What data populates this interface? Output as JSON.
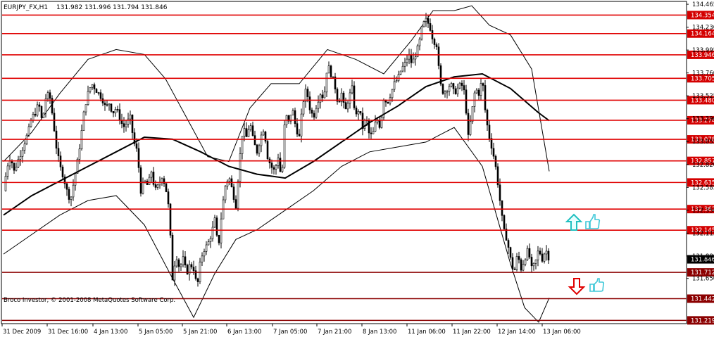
{
  "header": {
    "symbol": "EURJPY_FX,H1",
    "ohlc": "131.982 131.996 131.794 131.846"
  },
  "footer": {
    "copyright": "Broco Investor, © 2001-2008 MetaQuotes Software Corp."
  },
  "colors": {
    "level_line": "#e00000",
    "level_line_dark": "#8b0000",
    "level_tag": "#d40000",
    "candle": "#000000",
    "band": "#000000",
    "price_tag": "#000000",
    "arrow_up": "#20c0c0",
    "arrow_down": "#e00000",
    "thumb": "#40c8d8"
  },
  "icons": {
    "arrow_up": "arrow-up-icon",
    "arrow_down": "arrow-down-icon",
    "thumb_up": "thumbs-up-icon",
    "thumb_down": "thumbs-down-icon"
  },
  "chart_data": {
    "type": "candlestick",
    "ylim": [
      131.2,
      134.48
    ],
    "y_ticks": [
      "134.465",
      "134.230",
      "133.995",
      "133.760",
      "133.525",
      "133.290",
      "133.055",
      "132.820",
      "132.585",
      "132.350",
      "132.115",
      "131.880",
      "131.650"
    ],
    "x_labels": [
      "31 Dec 2009",
      "31 Dec 16:00",
      "4 Jan 13:00",
      "5 Jan 05:00",
      "5 Jan 21:00",
      "6 Jan 13:00",
      "7 Jan 05:00",
      "7 Jan 21:00",
      "8 Jan 13:00",
      "11 Jan 06:00",
      "11 Jan 22:00",
      "12 Jan 14:00",
      "13 Jan 06:00"
    ],
    "levels": [
      {
        "label": "134.354",
        "value": 134.354
      },
      {
        "label": "134.164",
        "value": 134.164
      },
      {
        "label": "133.946",
        "value": 133.946
      },
      {
        "label": "133.705",
        "value": 133.705
      },
      {
        "label": "133.480",
        "value": 133.48
      },
      {
        "label": "133.274",
        "value": 133.274
      },
      {
        "label": "133.078",
        "value": 133.078
      },
      {
        "label": "132.857",
        "value": 132.857
      },
      {
        "label": "132.635",
        "value": 132.635
      },
      {
        "label": "132.362",
        "value": 132.362
      },
      {
        "label": "132.145",
        "value": 132.145
      },
      {
        "label": "131.712",
        "value": 131.712
      },
      {
        "label": "131.442",
        "value": 131.442
      },
      {
        "label": "131.219",
        "value": 131.219
      }
    ],
    "current_price": {
      "label": "131.846",
      "value": 131.846
    },
    "price_path": [
      [
        0,
        132.55
      ],
      [
        5,
        132.8
      ],
      [
        10,
        132.9
      ],
      [
        15,
        132.75
      ],
      [
        20,
        132.85
      ],
      [
        25,
        132.95
      ],
      [
        30,
        133.05
      ],
      [
        35,
        133.15
      ],
      [
        40,
        133.3
      ],
      [
        45,
        133.35
      ],
      [
        50,
        133.45
      ],
      [
        55,
        133.25
      ],
      [
        60,
        133.5
      ],
      [
        65,
        133.55
      ],
      [
        70,
        133.3
      ],
      [
        75,
        133.0
      ],
      [
        80,
        132.8
      ],
      [
        85,
        132.7
      ],
      [
        90,
        132.55
      ],
      [
        95,
        132.45
      ],
      [
        100,
        132.65
      ],
      [
        105,
        132.85
      ],
      [
        110,
        133.1
      ],
      [
        115,
        133.4
      ],
      [
        120,
        133.55
      ],
      [
        125,
        133.65
      ],
      [
        130,
        133.6
      ],
      [
        135,
        133.55
      ],
      [
        140,
        133.5
      ],
      [
        145,
        133.4
      ],
      [
        150,
        133.45
      ],
      [
        155,
        133.35
      ],
      [
        160,
        133.4
      ],
      [
        165,
        133.3
      ],
      [
        170,
        133.2
      ],
      [
        175,
        133.25
      ],
      [
        180,
        133.3
      ],
      [
        185,
        133.05
      ],
      [
        190,
        132.95
      ],
      [
        195,
        132.55
      ],
      [
        200,
        132.65
      ],
      [
        205,
        132.6
      ],
      [
        210,
        132.75
      ],
      [
        215,
        132.55
      ],
      [
        220,
        132.6
      ],
      [
        225,
        132.7
      ],
      [
        230,
        132.6
      ],
      [
        235,
        132.35
      ],
      [
        240,
        131.65
      ],
      [
        245,
        131.9
      ],
      [
        250,
        131.75
      ],
      [
        255,
        131.85
      ],
      [
        260,
        131.7
      ],
      [
        265,
        131.8
      ],
      [
        270,
        131.75
      ],
      [
        275,
        131.55
      ],
      [
        280,
        131.85
      ],
      [
        285,
        131.95
      ],
      [
        290,
        132.0
      ],
      [
        295,
        132.1
      ],
      [
        300,
        132.25
      ],
      [
        305,
        131.95
      ],
      [
        310,
        132.35
      ],
      [
        315,
        132.6
      ],
      [
        320,
        132.7
      ],
      [
        325,
        132.55
      ],
      [
        330,
        132.4
      ],
      [
        335,
        132.85
      ],
      [
        340,
        133.2
      ],
      [
        345,
        133.1
      ],
      [
        350,
        133.25
      ],
      [
        355,
        133.05
      ],
      [
        360,
        132.95
      ],
      [
        365,
        133.1
      ],
      [
        370,
        133.2
      ],
      [
        375,
        132.9
      ],
      [
        380,
        132.8
      ],
      [
        385,
        132.75
      ],
      [
        390,
        132.9
      ],
      [
        395,
        132.65
      ],
      [
        400,
        133.35
      ],
      [
        405,
        133.25
      ],
      [
        410,
        133.4
      ],
      [
        415,
        133.2
      ],
      [
        420,
        133.1
      ],
      [
        425,
        133.45
      ],
      [
        430,
        133.6
      ],
      [
        435,
        133.4
      ],
      [
        440,
        133.3
      ],
      [
        445,
        133.45
      ],
      [
        450,
        133.55
      ],
      [
        455,
        133.5
      ],
      [
        460,
        133.85
      ],
      [
        465,
        133.75
      ],
      [
        470,
        133.65
      ],
      [
        475,
        133.45
      ],
      [
        480,
        133.55
      ],
      [
        485,
        133.35
      ],
      [
        490,
        133.5
      ],
      [
        495,
        133.6
      ],
      [
        500,
        133.3
      ],
      [
        505,
        133.4
      ],
      [
        510,
        133.2
      ],
      [
        515,
        133.3
      ],
      [
        520,
        133.1
      ],
      [
        525,
        133.15
      ],
      [
        530,
        133.3
      ],
      [
        535,
        133.2
      ],
      [
        540,
        133.5
      ],
      [
        545,
        133.45
      ],
      [
        550,
        133.55
      ],
      [
        555,
        133.65
      ],
      [
        560,
        133.7
      ],
      [
        565,
        133.8
      ],
      [
        570,
        133.85
      ],
      [
        575,
        133.95
      ],
      [
        580,
        133.85
      ],
      [
        585,
        133.95
      ],
      [
        590,
        134.05
      ],
      [
        595,
        134.25
      ],
      [
        600,
        134.3
      ],
      [
        605,
        134.25
      ],
      [
        610,
        134.1
      ],
      [
        615,
        134.05
      ],
      [
        620,
        133.65
      ],
      [
        625,
        133.55
      ],
      [
        630,
        133.6
      ],
      [
        635,
        133.65
      ],
      [
        640,
        133.55
      ],
      [
        645,
        133.6
      ],
      [
        650,
        133.65
      ],
      [
        655,
        133.55
      ],
      [
        660,
        133.1
      ],
      [
        665,
        133.35
      ],
      [
        670,
        133.6
      ],
      [
        675,
        133.55
      ],
      [
        680,
        133.7
      ],
      [
        685,
        133.3
      ],
      [
        690,
        133.1
      ],
      [
        695,
        132.95
      ],
      [
        700,
        132.75
      ],
      [
        705,
        132.45
      ],
      [
        710,
        132.15
      ],
      [
        715,
        132.05
      ],
      [
        720,
        131.85
      ],
      [
        725,
        131.7
      ],
      [
        730,
        131.9
      ],
      [
        735,
        131.75
      ],
      [
        740,
        131.85
      ],
      [
        745,
        131.95
      ],
      [
        750,
        131.75
      ],
      [
        755,
        131.8
      ],
      [
        760,
        131.95
      ],
      [
        765,
        131.85
      ],
      [
        770,
        131.95
      ],
      [
        775,
        131.846
      ]
    ],
    "ma_path": [
      [
        0,
        132.3
      ],
      [
        40,
        132.5
      ],
      [
        80,
        132.65
      ],
      [
        120,
        132.8
      ],
      [
        160,
        132.95
      ],
      [
        200,
        133.1
      ],
      [
        240,
        133.08
      ],
      [
        280,
        132.95
      ],
      [
        320,
        132.8
      ],
      [
        360,
        132.72
      ],
      [
        400,
        132.68
      ],
      [
        440,
        132.85
      ],
      [
        480,
        133.05
      ],
      [
        520,
        133.25
      ],
      [
        560,
        133.42
      ],
      [
        600,
        133.62
      ],
      [
        640,
        133.72
      ],
      [
        680,
        133.75
      ],
      [
        720,
        133.6
      ],
      [
        760,
        133.35
      ],
      [
        775,
        133.27
      ]
    ],
    "upper_band_path": [
      [
        0,
        132.85
      ],
      [
        40,
        133.15
      ],
      [
        80,
        133.55
      ],
      [
        120,
        133.9
      ],
      [
        160,
        134.0
      ],
      [
        200,
        133.95
      ],
      [
        230,
        133.7
      ],
      [
        260,
        133.3
      ],
      [
        290,
        132.9
      ],
      [
        320,
        132.85
      ],
      [
        350,
        133.4
      ],
      [
        380,
        133.65
      ],
      [
        420,
        133.65
      ],
      [
        460,
        134.0
      ],
      [
        500,
        133.9
      ],
      [
        540,
        133.75
      ],
      [
        580,
        134.1
      ],
      [
        610,
        134.4
      ],
      [
        640,
        134.4
      ],
      [
        665,
        134.45
      ],
      [
        690,
        134.25
      ],
      [
        720,
        134.15
      ],
      [
        750,
        133.8
      ],
      [
        775,
        132.75
      ]
    ],
    "lower_band_path": [
      [
        0,
        131.9
      ],
      [
        40,
        132.1
      ],
      [
        80,
        132.3
      ],
      [
        120,
        132.45
      ],
      [
        160,
        132.5
      ],
      [
        200,
        132.2
      ],
      [
        240,
        131.65
      ],
      [
        270,
        131.25
      ],
      [
        300,
        131.7
      ],
      [
        330,
        132.05
      ],
      [
        360,
        132.15
      ],
      [
        400,
        132.35
      ],
      [
        440,
        132.55
      ],
      [
        480,
        132.8
      ],
      [
        520,
        132.95
      ],
      [
        560,
        133.0
      ],
      [
        600,
        133.05
      ],
      [
        640,
        133.2
      ],
      [
        680,
        132.8
      ],
      [
        700,
        132.3
      ],
      [
        720,
        131.8
      ],
      [
        740,
        131.35
      ],
      [
        760,
        131.2
      ],
      [
        775,
        131.45
      ]
    ]
  }
}
